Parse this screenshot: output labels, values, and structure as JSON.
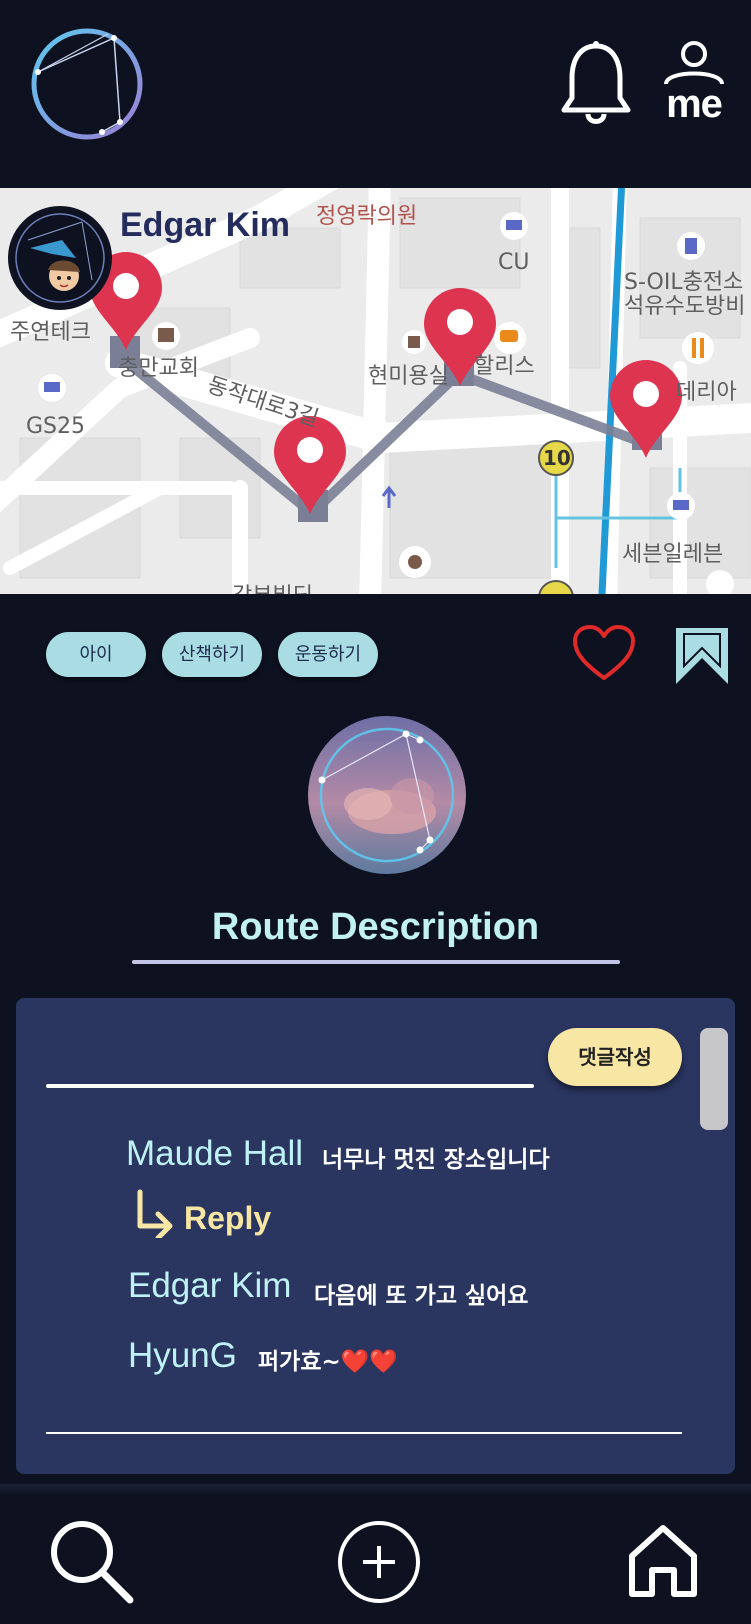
{
  "header": {
    "logo_icon": "constellation-logo-icon",
    "notification_icon": "bell-icon",
    "profile_label": "me"
  },
  "map": {
    "user_name": "Edgar Kim",
    "labels": {
      "l1": "정영락의원",
      "l2": "CU",
      "l3": "S-OIL충전소",
      "l4": "석유수도방비",
      "l5": "주연테크",
      "l6": "충만교회",
      "l7": "현미용실",
      "l8": "할리스",
      "l9": "데리아",
      "l10": "GS25",
      "l11": "동작대로3길",
      "l12": "10",
      "l13": "세븐일레븐",
      "l14": "갑부빌딩"
    },
    "route_color": "#7a7f96",
    "pin_color": "#dd3550"
  },
  "tags": [
    "아이",
    "산책하기",
    "운동하기"
  ],
  "route": {
    "title": "Route Description"
  },
  "comments": {
    "write_button": "댓글작성",
    "reply_label": "Reply",
    "items": [
      {
        "name": "Maude Hall",
        "text": "너무나 멋진 장소입니다"
      },
      {
        "name": "Edgar Kim",
        "text": "다음에 또 가고 싶어요"
      },
      {
        "name": "HyunG",
        "text": "퍼가효~❤️❤️"
      }
    ]
  },
  "nav": {
    "search_icon": "search-icon",
    "add_icon": "add-circle-icon",
    "home_icon": "home-icon"
  },
  "colors": {
    "background": "#0e1220",
    "panel": "#2a3560",
    "tag": "#a9dde3",
    "accent_yellow": "#f8e6a4",
    "heart": "#e02a2a",
    "title_cyan": "#c2f1f1"
  }
}
